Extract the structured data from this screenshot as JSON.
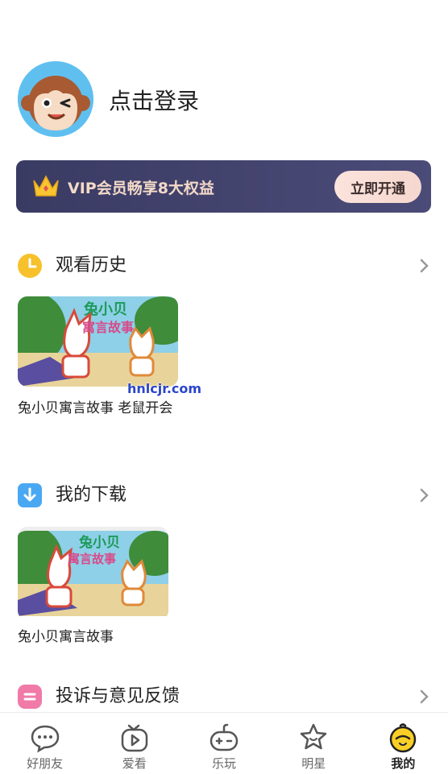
{
  "profile": {
    "login_label": "点击登录"
  },
  "vip": {
    "text": "VIP会员畅享8大权益",
    "button": "立即开通"
  },
  "history": {
    "title": "观看历史",
    "items": [
      {
        "caption": "兔小贝寓言故事 老鼠开会"
      }
    ]
  },
  "downloads": {
    "title": "我的下载",
    "items": [
      {
        "caption": "兔小贝寓言故事"
      }
    ]
  },
  "feedback": {
    "title": "投诉与意见反馈"
  },
  "watermark": "hnlcjr.com",
  "nav": {
    "items": [
      {
        "label": "好朋友",
        "icon": "chat-bubble-icon"
      },
      {
        "label": "爱看",
        "icon": "tv-play-icon"
      },
      {
        "label": "乐玩",
        "icon": "gamepad-icon"
      },
      {
        "label": "明星",
        "icon": "star-face-icon"
      },
      {
        "label": "我的",
        "icon": "chick-face-icon"
      }
    ],
    "active_index": 4
  },
  "colors": {
    "vip_bg": "#3a3b63",
    "vip_text": "#f3d9c8",
    "history_icon": "#f7c12c",
    "download_icon": "#4aa8f3",
    "feedback_icon": "#f07aa8"
  }
}
